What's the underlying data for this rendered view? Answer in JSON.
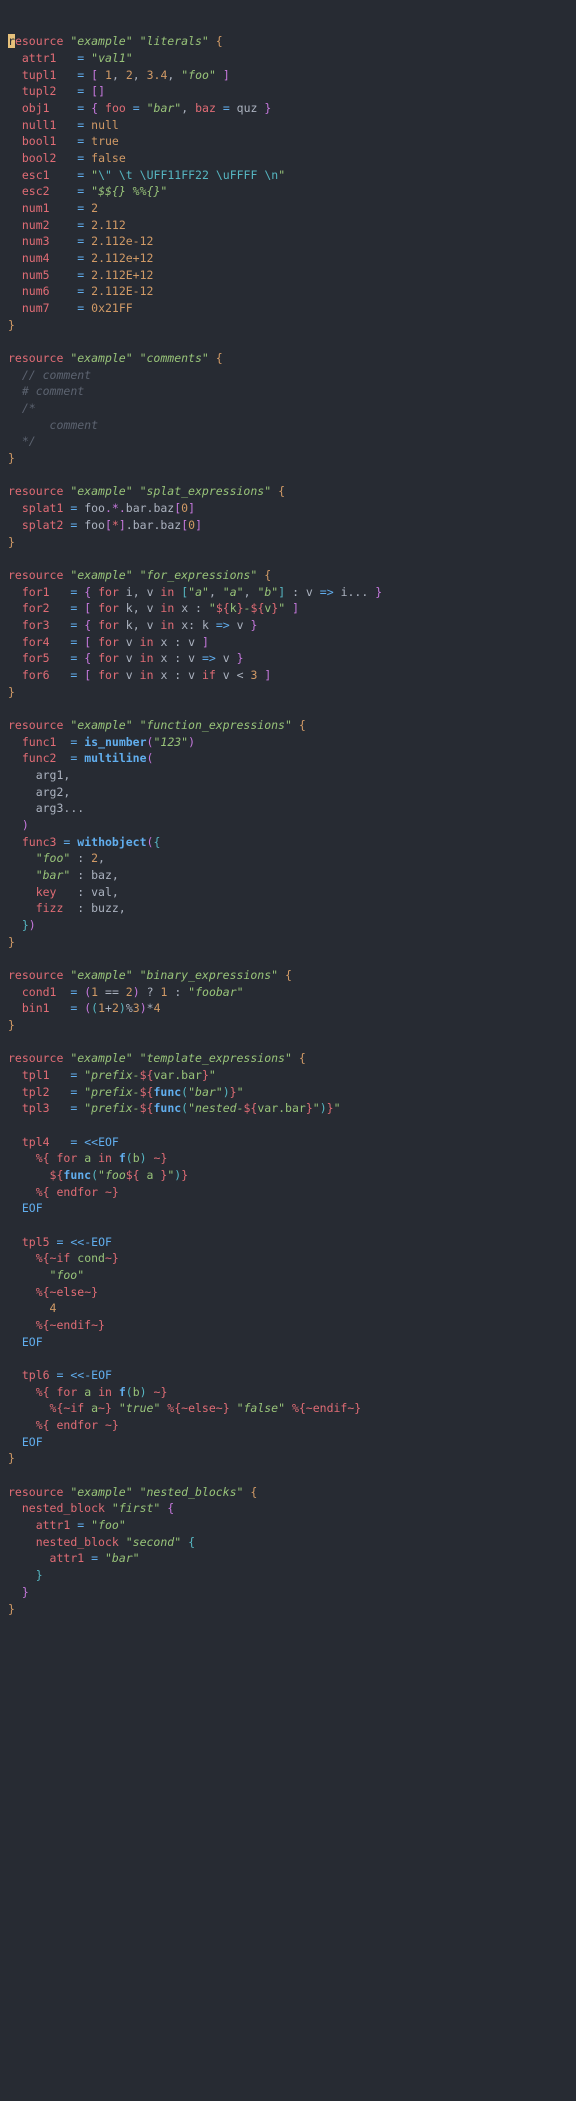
{
  "blocks": {
    "literals": {
      "type": "resource",
      "label1": "\"example\"",
      "label2": "\"literals\"",
      "attrs": {
        "attr1": "\"val1\"",
        "tupl1": "[ 1, 2, 3.4, \"foo\" ]",
        "tupl2": "[]",
        "obj1": "{ foo = \"bar\", baz = quz }",
        "null1": "null",
        "bool1": "true",
        "bool2": "false",
        "esc1": "\"\\\" \\t \\UFF11FF22 \\uFFFF \\n\"",
        "esc2": "\"$${} %%{}\"",
        "num1": "2",
        "num2": "2.112",
        "num3": "2.112e-12",
        "num4": "2.112e+12",
        "num5": "2.112E+12",
        "num6": "2.112E-12",
        "num7": "0x21FF"
      }
    },
    "comments": {
      "type": "resource",
      "label1": "\"example\"",
      "label2": "\"comments\"",
      "lines": [
        "// comment",
        "# comment",
        "/*",
        "    comment",
        "*/"
      ]
    },
    "splat": {
      "type": "resource",
      "label1": "\"example\"",
      "label2": "\"splat_expressions\"",
      "attrs": {
        "splat1": "foo.*.bar.baz[0]",
        "splat2": "foo[*].bar.baz[0]"
      }
    },
    "for": {
      "type": "resource",
      "label1": "\"example\"",
      "label2": "\"for_expressions\"",
      "attrs": {
        "for1": "{ for i, v in [\"a\", \"a\", \"b\"] : v => i... }",
        "for2": "[ for k, v in x : \"${k}-${v}\" ]",
        "for3": "{ for k, v in x: k => v }",
        "for4": "[ for v in x : v ]",
        "for5": "{ for v in x : v => v }",
        "for6": "[ for v in x : v if v < 3 ]"
      }
    },
    "func": {
      "type": "resource",
      "label1": "\"example\"",
      "label2": "\"function_expressions\"",
      "attrs": {
        "func1": "is_number(\"123\")",
        "func2": "multiline(",
        "func2_args": [
          "arg1,",
          "arg2,",
          "arg3..."
        ],
        "func3": "withobject({",
        "func3_body": {
          "\"foo\"": "2",
          "\"bar\"": "baz",
          "key": "val",
          "fizz": "buzz"
        }
      }
    },
    "binary": {
      "type": "resource",
      "label1": "\"example\"",
      "label2": "\"binary_expressions\"",
      "attrs": {
        "cond1": "(1 == 2) ? 1 : \"foobar\"",
        "bin1": "((1+2)%3)*4"
      }
    },
    "template": {
      "type": "resource",
      "label1": "\"example\"",
      "label2": "\"template_expressions\"",
      "attrs": {
        "tpl1": "\"prefix-${var.bar}\"",
        "tpl2": "\"prefix-${func(\"bar\")}\"",
        "tpl3": "\"prefix-${func(\"nested-${var.bar}\")}\"",
        "tpl4": "<<EOF",
        "tpl4_body": [
          "%{ for a in f(b) ~}",
          "${func(\"foo${ a }\")}",
          "%{ endfor ~}"
        ],
        "tpl5": "<<-EOF",
        "tpl5_body": [
          "%{~if cond~}",
          "\"foo\"",
          "%{~else~}",
          "4",
          "%{~endif~}"
        ],
        "tpl6": "<<-EOF",
        "tpl6_body": [
          "%{ for a in f(b) ~}",
          "%{~if a~} \"true\" %{~else~} \"false\" %{~endif~}",
          "%{ endfor ~}"
        ]
      }
    },
    "nested": {
      "type": "resource",
      "label1": "\"example\"",
      "label2": "\"nested_blocks\"",
      "inner1": {
        "type": "nested_block",
        "label": "\"first\"",
        "attr1": "\"foo\""
      },
      "inner2": {
        "type": "nested_block",
        "label": "\"second\"",
        "attr1": "\"bar\""
      }
    }
  },
  "chart_data": null
}
